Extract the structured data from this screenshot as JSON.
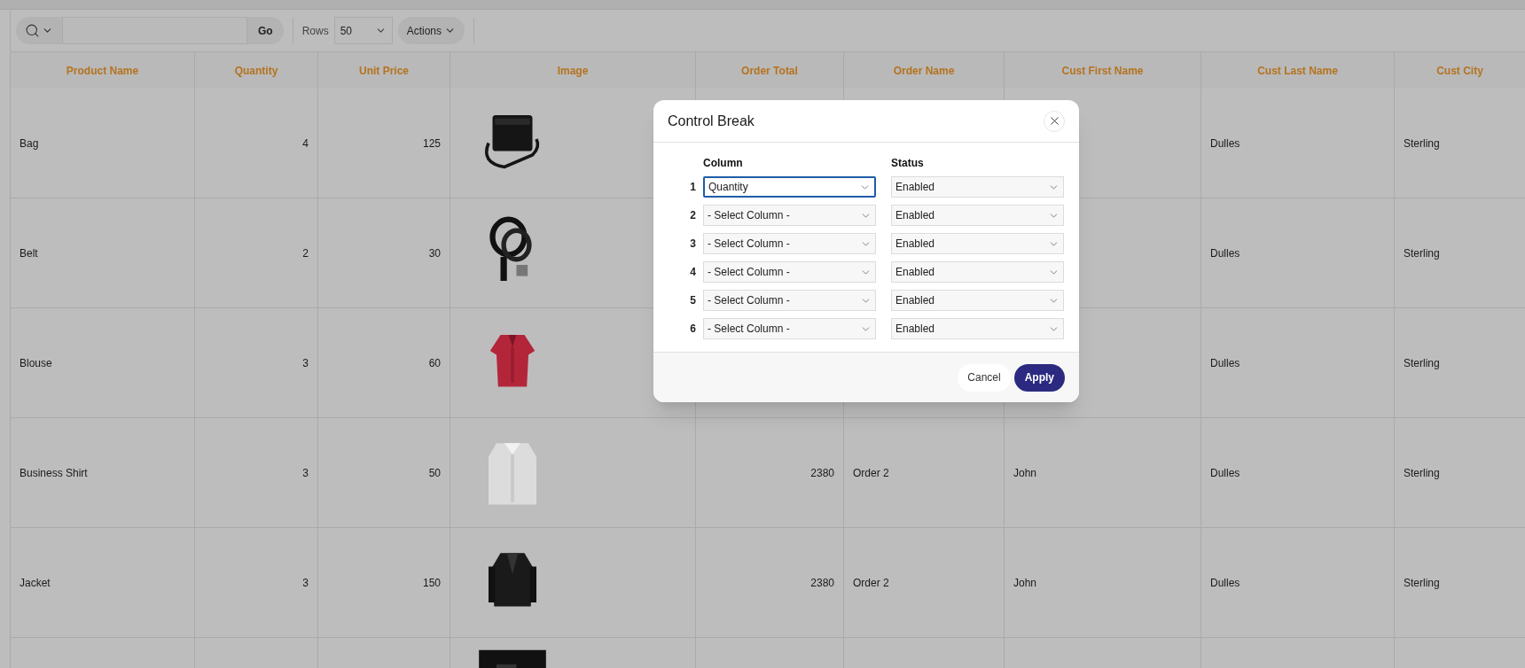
{
  "toolbar": {
    "go_button": "Go",
    "rows_label": "Rows",
    "rows_value": "50",
    "actions_button": "Actions"
  },
  "table": {
    "columns": [
      {
        "label": "Product Name",
        "kind": "text"
      },
      {
        "label": "Quantity",
        "kind": "number"
      },
      {
        "label": "Unit Price",
        "kind": "number"
      },
      {
        "label": "Image"
      },
      {
        "label": "Order Total",
        "kind": "number"
      },
      {
        "label": "Order Name",
        "kind": "text"
      },
      {
        "label": "Cust First Name",
        "kind": "text"
      },
      {
        "label": "Cust Last Name",
        "kind": "text"
      },
      {
        "label": "Cust City",
        "kind": "text"
      }
    ],
    "rows": [
      {
        "cells": [
          "Bag",
          "4",
          "125",
          {
            "kind": "picture"
          },
          null,
          null,
          null,
          "Dulles",
          "Sterling"
        ]
      },
      {
        "cells": [
          "Belt",
          "2",
          "30",
          {
            "kind": "picture"
          },
          null,
          null,
          null,
          "Dulles",
          "Sterling"
        ]
      },
      {
        "cells": [
          "Blouse",
          "3",
          "60",
          {
            "kind": "picture"
          },
          null,
          null,
          null,
          "Dulles",
          "Sterling"
        ]
      },
      {
        "cells": [
          "Business Shirt",
          "3",
          "50",
          {
            "kind": "picture"
          },
          "2380",
          "Order 2",
          "John",
          "Dulles",
          "Sterling"
        ]
      },
      {
        "cells": [
          "Jacket",
          "3",
          "150",
          {
            "kind": "picture"
          },
          "2380",
          "Order 2",
          "John",
          "Dulles",
          "Sterling"
        ]
      },
      {
        "cells": [
          null,
          null,
          null,
          {
            "kind": "picture"
          },
          null,
          null,
          null,
          null,
          null
        ]
      }
    ]
  },
  "dialog": {
    "title": "Control Break",
    "column_header": "Column",
    "status_header": "Status",
    "rows": [
      {
        "number": "1",
        "column": "Quantity",
        "status": "Enabled",
        "focused": true
      },
      {
        "number": "2",
        "column": "- Select Column -",
        "status": "Enabled",
        "focused": false
      },
      {
        "number": "3",
        "column": "- Select Column -",
        "status": "Enabled",
        "focused": false
      },
      {
        "number": "4",
        "column": "- Select Column -",
        "status": "Enabled",
        "focused": false
      },
      {
        "number": "5",
        "column": "- Select Column -",
        "status": "Enabled",
        "focused": false
      },
      {
        "number": "6",
        "column": "- Select Column -",
        "status": "Enabled",
        "focused": false
      }
    ],
    "cancel_button": "Cancel",
    "apply_button": "Apply"
  }
}
